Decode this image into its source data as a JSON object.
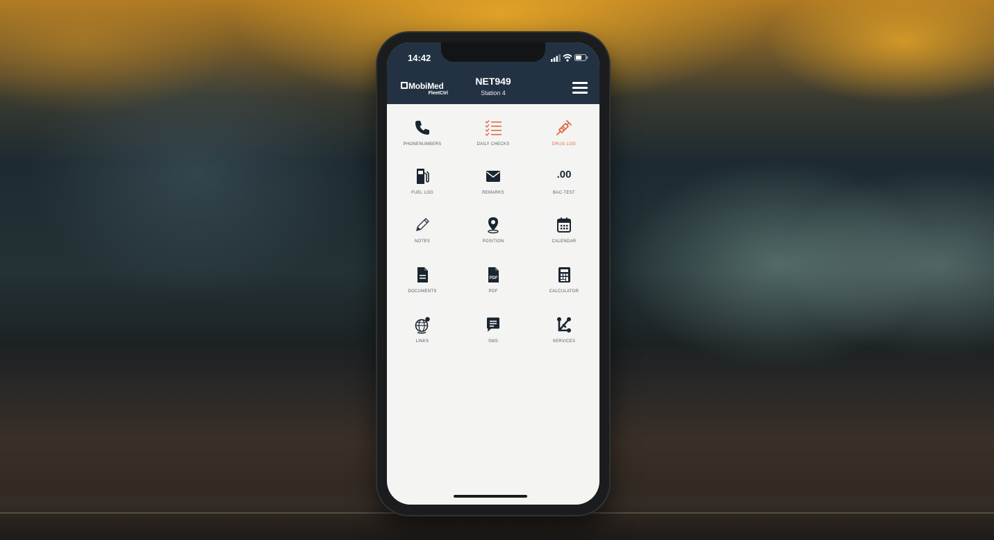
{
  "status_bar": {
    "time": "14:42",
    "icons": [
      "signal-icon",
      "wifi-icon",
      "battery-icon"
    ]
  },
  "header": {
    "logo_name": "MobiMed",
    "logo_sub": "FleetCtrl",
    "title": "NET949",
    "subtitle": "Station 4",
    "menu_icon": "hamburger-menu-icon"
  },
  "colors": {
    "header_bg": "#223242",
    "accent_orange": "#e06a43",
    "icon_dark": "#1a2530",
    "screen_bg": "#f4f4f2"
  },
  "tiles": [
    {
      "label": "PHONENUMBERS",
      "icon": "phone-icon"
    },
    {
      "label": "DAILY CHECKS",
      "icon": "checklist-icon"
    },
    {
      "label": "DRUG LOG",
      "icon": "syringe-icon"
    },
    {
      "label": "FUEL LOG",
      "icon": "fuel-pump-icon"
    },
    {
      "label": "REMARKS",
      "icon": "envelope-icon"
    },
    {
      "label": "BAC-TEST",
      "icon": "bac-text-icon",
      "icon_text": ".00"
    },
    {
      "label": "NOTES",
      "icon": "pencil-icon"
    },
    {
      "label": "POSITION",
      "icon": "map-pin-icon"
    },
    {
      "label": "CALENDAR",
      "icon": "calendar-icon"
    },
    {
      "label": "DOCUMENTS",
      "icon": "document-icon"
    },
    {
      "label": "PDF",
      "icon": "pdf-icon",
      "icon_text": "PDF"
    },
    {
      "label": "CALCULATOR",
      "icon": "calculator-icon"
    },
    {
      "label": "LINKS",
      "icon": "globe-icon"
    },
    {
      "label": "SMS",
      "icon": "chat-icon"
    },
    {
      "label": "SERVICES",
      "icon": "connections-icon"
    }
  ]
}
